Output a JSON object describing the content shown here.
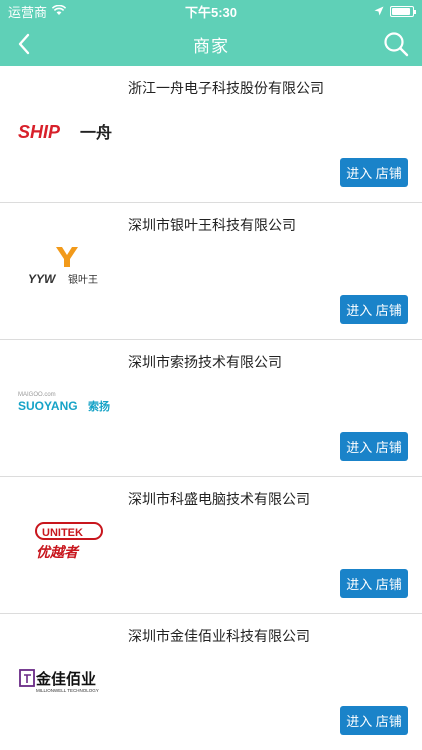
{
  "status_bar": {
    "carrier": "运营商",
    "time": "下午5:30",
    "battery_level": 0.9
  },
  "header": {
    "title": "商家",
    "back_icon": "chevron-left-icon",
    "search_icon": "search-icon"
  },
  "merchants": [
    {
      "name": "浙江一舟电子科技股份有限公司",
      "logo_text": "SHIP",
      "logo_sub": "一舟",
      "button_label": "进入 店铺"
    },
    {
      "name": "深圳市银叶王科技有限公司",
      "logo_text": "YYW",
      "logo_sub": "银叶王",
      "button_label": "进入 店铺"
    },
    {
      "name": "深圳市索扬技术有限公司",
      "logo_text": "SUOYANG",
      "logo_sub": "索扬",
      "logo_small": "MAIGOO.com",
      "button_label": "进入 店铺"
    },
    {
      "name": "深圳市科盛电脑技术有限公司",
      "logo_text": "UNITEK",
      "logo_sub": "优越者",
      "button_label": "进入 店铺"
    },
    {
      "name": "深圳市金佳佰业科技有限公司",
      "logo_text": "金佳佰业",
      "logo_sub": "MILLIONWELL TECHNOLOGY",
      "button_label": "进入 店铺"
    }
  ],
  "colors": {
    "header_bg": "#5fd0b7",
    "button_bg": "#1a83c9",
    "ship_red": "#d8202a",
    "yyw_orange": "#f29a1a",
    "suoyang_teal": "#16a3c7",
    "unitek_red": "#c8161d",
    "millionwell_purple": "#6a2a86"
  }
}
